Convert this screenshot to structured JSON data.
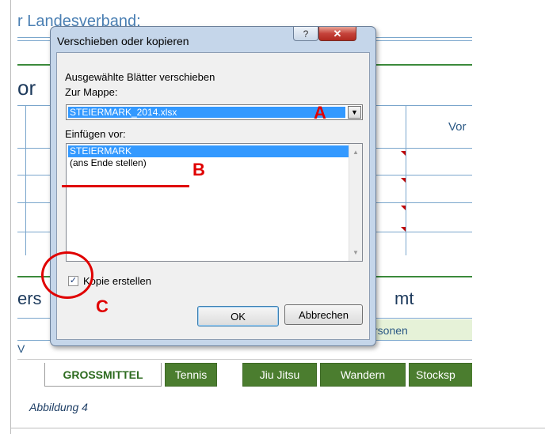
{
  "background": {
    "header_text": "r Landesverband:",
    "left_fragment_1": "or",
    "left_fragment_2": "ers",
    "left_fragment_3": "V",
    "right_fragment_vor": "Vor",
    "right_fragment_mt": "mt",
    "right_fragment_personen": "rsonen",
    "sheet_tabs": [
      {
        "label": "GROSSMITTEL",
        "active": true
      },
      {
        "label": "Tennis",
        "active": false
      },
      {
        "label": "Jiu Jitsu",
        "active": false
      },
      {
        "label": "Wandern",
        "active": false
      },
      {
        "label": "Stocksp",
        "active": false
      }
    ]
  },
  "dialog": {
    "title": "Verschieben oder kopieren",
    "help_glyph": "?",
    "close_glyph": "✕",
    "label_moving": "Ausgewählte Blätter verschieben",
    "label_workbook": "Zur Mappe:",
    "workbook_value": "STEIERMARK_2014.xlsx",
    "label_insert_before": "Einfügen vor:",
    "insert_before_items": [
      {
        "label": "STEIERMARK",
        "selected": true
      },
      {
        "label": "(ans Ende stellen)",
        "selected": false
      }
    ],
    "copy_checkbox_label": "Kopie erstellen",
    "copy_checked": true,
    "ok_label": "OK",
    "cancel_label": "Abbrechen"
  },
  "annotations": {
    "a": "A",
    "b": "B",
    "c": "C",
    "color": "#e00000"
  },
  "caption": "Abbildung 4"
}
